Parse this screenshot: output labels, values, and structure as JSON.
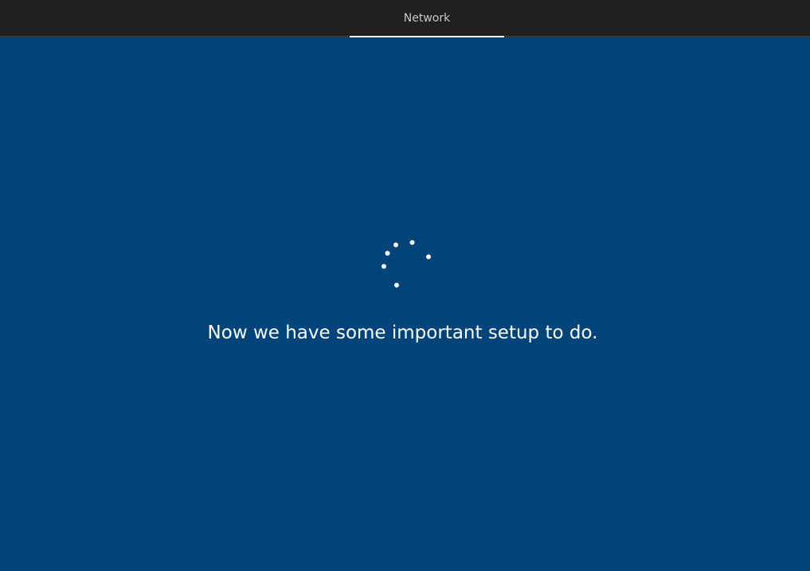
{
  "header": {
    "tabs": [
      {
        "label": "Network",
        "active": true
      }
    ]
  },
  "main": {
    "status_message": "Now we have some important setup to do.",
    "spinner": {
      "icon": "loading-spinner-icon",
      "dot_count": 6
    }
  },
  "colors": {
    "background": "#00447a",
    "topbar": "#202020",
    "text": "#ffffff"
  }
}
